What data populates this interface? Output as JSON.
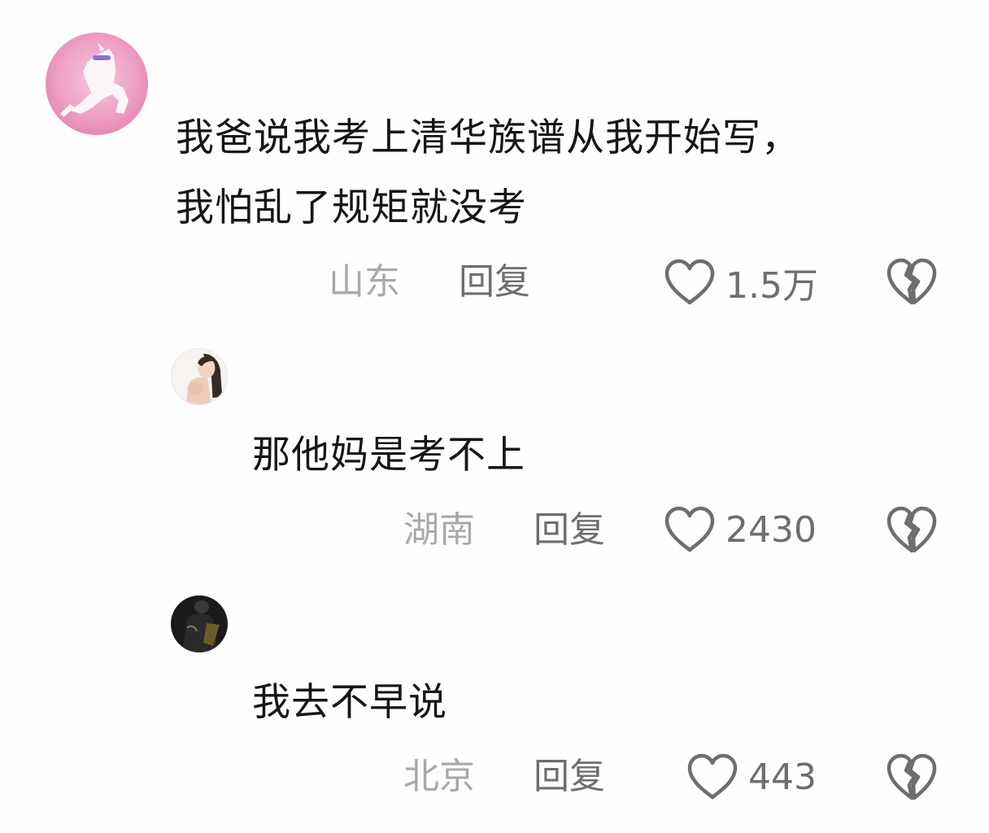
{
  "comments": [
    {
      "avatar_icon": "pink-horse-avatar",
      "text_line1": "我爸说我考上清华族谱从我开始写，",
      "text_line2": "我怕乱了规矩就没考",
      "location": "山东",
      "reply_label": "回复",
      "likes": "1.5万"
    },
    {
      "avatar_icon": "woman-avatar",
      "text_line1": "那他妈是考不上",
      "location": "湖南",
      "reply_label": "回复",
      "likes": "2430"
    },
    {
      "avatar_icon": "dark-figure-avatar",
      "text_line1": "我去不早说",
      "location": "北京",
      "reply_label": "回复",
      "likes": "443"
    }
  ],
  "icons": {
    "like": "heart-icon",
    "dislike": "broken-heart-icon"
  },
  "colors": {
    "text": "#161616",
    "location": "#a9a9a9",
    "meta": "#6e6e6e",
    "icon_stroke": "#6e6e6e"
  }
}
